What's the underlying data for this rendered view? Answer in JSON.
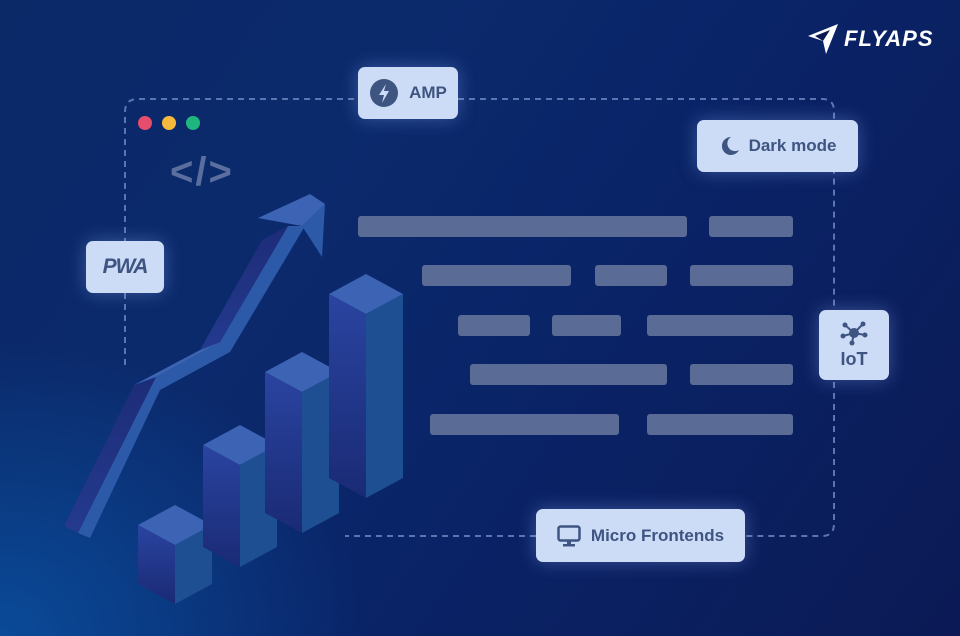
{
  "brand": {
    "name": "FLYAPS"
  },
  "window": {
    "traffic_lights": [
      {
        "name": "close",
        "color": "#e64c6c"
      },
      {
        "name": "minimize",
        "color": "#f5b93c"
      },
      {
        "name": "maximize",
        "color": "#1fb57f"
      }
    ],
    "code_glyph": "</>"
  },
  "badges": {
    "amp": {
      "label": "AMP",
      "icon": "lightning-icon"
    },
    "dark_mode": {
      "label": "Dark mode",
      "icon": "moon-icon"
    },
    "pwa": {
      "label": "PWA",
      "icon": "pwa-logo"
    },
    "iot": {
      "label": "IoT",
      "icon": "network-hub-icon"
    },
    "micro_frontends": {
      "label": "Micro Frontends",
      "icon": "monitor-icon"
    }
  },
  "colors": {
    "background_dark": "#0b1a55",
    "background_mid": "#0b2a6c",
    "badge_bg": "#cddcf6",
    "badge_text": "#3e5582",
    "placeholder_bar": "#5a6b95",
    "bar_top": "#3d64b4",
    "bar_right": "#1f4f93",
    "bar_left": "#23368a"
  },
  "growth_chart": {
    "bars": [
      1,
      2,
      3,
      4
    ],
    "trend": "rising-arrow"
  }
}
